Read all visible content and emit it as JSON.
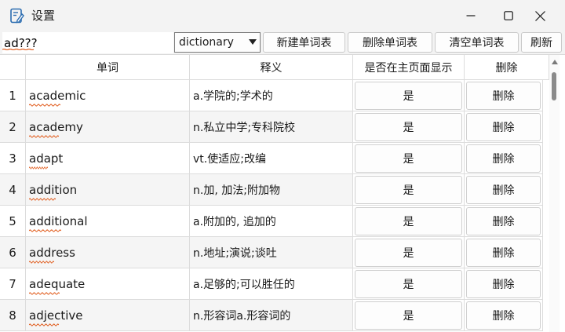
{
  "window": {
    "title": "设置",
    "icon": "notepad-pencil-icon",
    "controls": [
      "minimize-icon",
      "maximize-icon",
      "close-icon"
    ]
  },
  "toolbar": {
    "search_value": "ad???",
    "dictionary_select": "dictionary",
    "new_wordlist_label": "新建单词表",
    "delete_wordlist_label": "删除单词表",
    "clear_wordlist_label": "清空单词表",
    "refresh_label": "刷新"
  },
  "table": {
    "headers": [
      "单词",
      "释义",
      "是否在主页面显示",
      "删除"
    ],
    "rows": [
      {
        "num": "1",
        "word": "academic",
        "meaning": "a.学院的;学术的",
        "show": "是",
        "delete": "删除"
      },
      {
        "num": "2",
        "word": "academy",
        "meaning": "n.私立中学;专科院校",
        "show": "是",
        "delete": "删除"
      },
      {
        "num": "3",
        "word": "adapt",
        "meaning": "vt.使适应;改编",
        "show": "是",
        "delete": "删除"
      },
      {
        "num": "4",
        "word": "addition",
        "meaning": "n.加, 加法;附加物",
        "show": "是",
        "delete": "删除"
      },
      {
        "num": "5",
        "word": "additional",
        "meaning": "a.附加的, 追加的",
        "show": "是",
        "delete": "删除"
      },
      {
        "num": "6",
        "word": "address",
        "meaning": "n.地址;演说;谈吐",
        "show": "是",
        "delete": "删除"
      },
      {
        "num": "7",
        "word": "adequate",
        "meaning": "a.足够的;可以胜任的",
        "show": "是",
        "delete": "删除"
      },
      {
        "num": "8",
        "word": "adjective",
        "meaning": "n.形容词a.形容词的",
        "show": "是",
        "delete": "删除"
      }
    ]
  },
  "colors": {
    "accent": "#f07020",
    "background": "#f3f3f3",
    "grid": "#dcdcdc"
  }
}
